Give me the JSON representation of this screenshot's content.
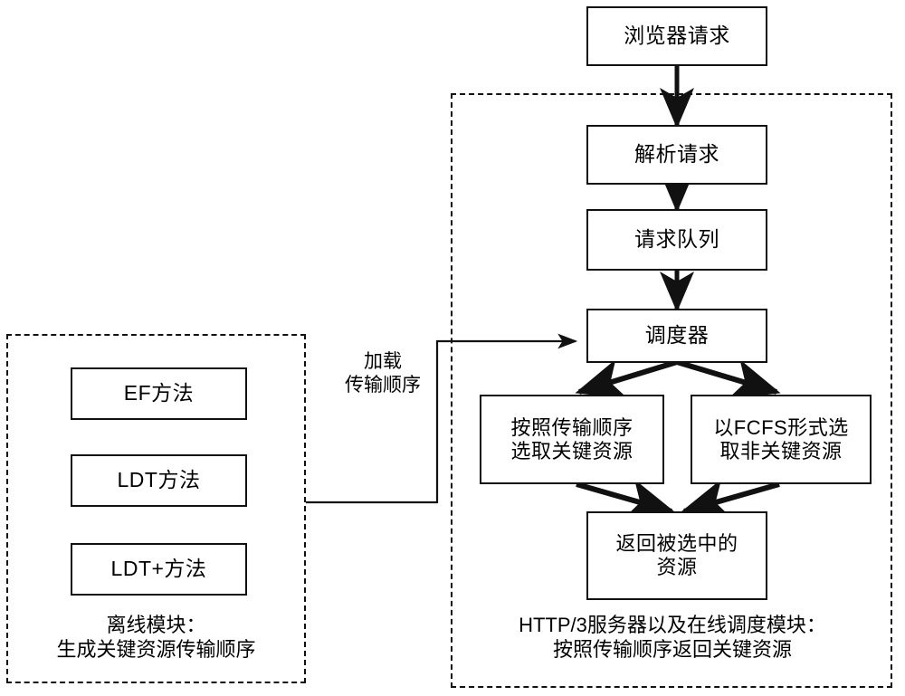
{
  "diagram": {
    "title_hidden": "",
    "groups": [
      {
        "id": "offline-module",
        "caption": "离线模块：\n生成关键资源传输顺序"
      },
      {
        "id": "online-module",
        "caption": "HTTP/3服务器以及在线调度模块：\n按照传输顺序返回关键资源"
      }
    ],
    "nodes": {
      "browser_request": "浏览器请求",
      "parse_request": "解析请求",
      "request_queue": "请求队列",
      "scheduler": "调度器",
      "select_key": "按照传输顺序\n选取关键资源",
      "select_nonkey": "以FCFS形式选\n取非关键资源",
      "return_selected": "返回被选中的\n资源",
      "method_ef": "EF方法",
      "method_ldt": "LDT方法",
      "method_ldt_plus": "LDT+方法"
    },
    "edges": {
      "load_order_label": "加载\n传输顺序"
    },
    "colors": {
      "stroke": "#111111",
      "background": "#ffffff",
      "text": "#000000"
    }
  }
}
